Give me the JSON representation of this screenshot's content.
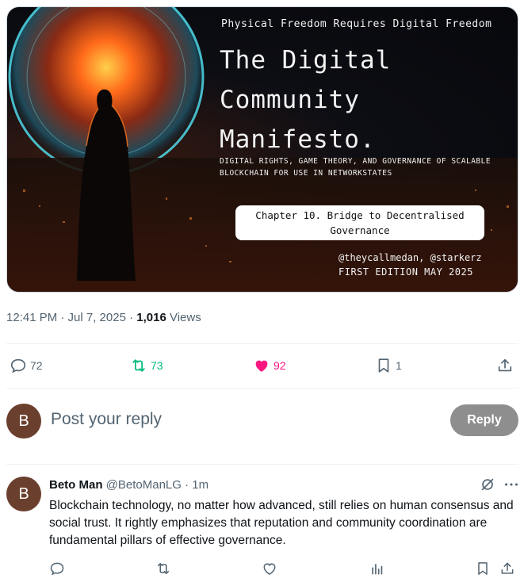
{
  "media": {
    "tagline": "Physical Freedom Requires Digital Freedom",
    "title_line1": "The Digital",
    "title_line2": "Community",
    "title_line3": "Manifesto.",
    "subtitle_line1": "DIGITAL RIGHTS, GAME THEORY, AND GOVERNANCE OF SCALABLE",
    "subtitle_line2": "BLOCKCHAIN FOR USE IN NETWORKSTATES",
    "chapter_line1": "Chapter 10. Bridge to Decentralised",
    "chapter_line2": "Governance",
    "authors": "@theycallmedan, @starkerz",
    "edition": "FIRST EDITION MAY 2025"
  },
  "meta": {
    "time_date": "12:41 PM · Jul 7, 2025 · ",
    "views_count": "1,016",
    "views_label": " Views"
  },
  "actions": {
    "replies": "72",
    "reposts": "73",
    "likes": "92",
    "bookmarks": "1"
  },
  "colors": {
    "repost_green": "#00ba7c",
    "like_pink": "#f91880",
    "muted": "#536471",
    "reply_button": "#8e8e8e"
  },
  "composer": {
    "avatar_letter": "B",
    "placeholder": "Post your reply",
    "reply_button": "Reply"
  },
  "reply": {
    "avatar_letter": "B",
    "name": "Beto Man",
    "handle": "@BetoManLG",
    "time": "· 1m",
    "text": "Blockchain technology, no matter how advanced, still relies on human consensus and social trust. It rightly emphasizes that reputation and community coordination are fundamental pillars of effective governance."
  }
}
